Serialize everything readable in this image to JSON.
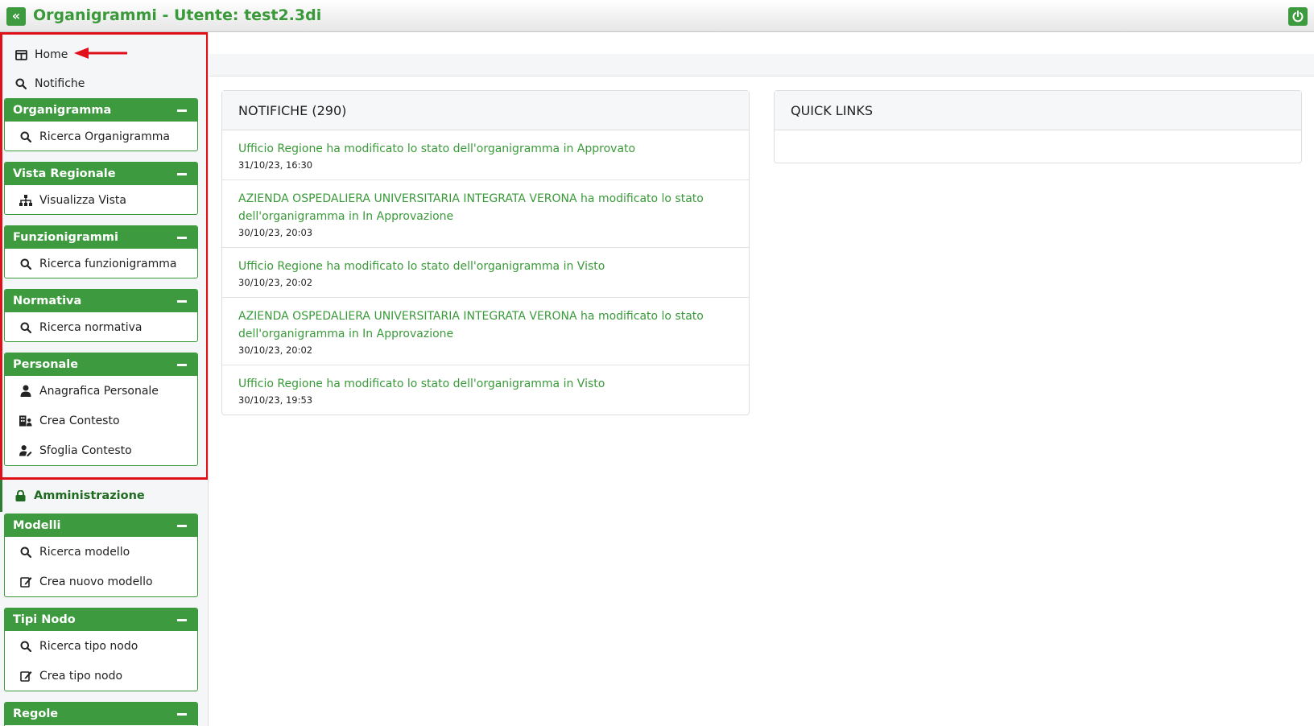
{
  "app": {
    "title": "Organigrammi - Utente: test2.3di",
    "collapse_glyph": "«"
  },
  "colors": {
    "brand_green": "#3e9a3e",
    "link_green": "#3a9a3a",
    "highlight_red": "#e0101a"
  },
  "sidebar": {
    "home": "Home",
    "notifiche": "Notifiche",
    "sections": [
      {
        "title": "Organigramma",
        "items": [
          {
            "label": "Ricerca Organigramma",
            "icon": "search-icon"
          }
        ]
      },
      {
        "title": "Vista Regionale",
        "items": [
          {
            "label": "Visualizza Vista",
            "icon": "sitemap-icon"
          }
        ]
      },
      {
        "title": "Funzionigrammi",
        "items": [
          {
            "label": "Ricerca funzionigramma",
            "icon": "search-icon"
          }
        ]
      },
      {
        "title": "Normativa",
        "items": [
          {
            "label": "Ricerca normativa",
            "icon": "search-icon"
          }
        ]
      },
      {
        "title": "Personale",
        "items": [
          {
            "label": "Anagrafica Personale",
            "icon": "user-icon"
          },
          {
            "label": "Crea Contesto",
            "icon": "building-user-icon"
          },
          {
            "label": "Sfoglia Contesto",
            "icon": "user-pen-icon"
          }
        ]
      }
    ],
    "admin_label": "Amministrazione",
    "admin_sections": [
      {
        "title": "Modelli",
        "items": [
          {
            "label": "Ricerca modello",
            "icon": "search-icon"
          },
          {
            "label": "Crea nuovo modello",
            "icon": "edit-icon"
          }
        ]
      },
      {
        "title": "Tipi Nodo",
        "items": [
          {
            "label": "Ricerca tipo nodo",
            "icon": "search-icon"
          },
          {
            "label": "Crea tipo nodo",
            "icon": "edit-icon"
          }
        ]
      },
      {
        "title": "Regole",
        "items": []
      }
    ]
  },
  "notifications": {
    "header": "NOTIFICHE (290)",
    "items": [
      {
        "message": "Ufficio Regione ha modificato lo stato dell'organigramma in Approvato",
        "time": "31/10/23, 16:30"
      },
      {
        "message": "AZIENDA OSPEDALIERA UNIVERSITARIA INTEGRATA VERONA ha modificato lo stato dell'organigramma in In Approvazione",
        "time": "30/10/23, 20:03"
      },
      {
        "message": "Ufficio Regione ha modificato lo stato dell'organigramma in Visto",
        "time": "30/10/23, 20:02"
      },
      {
        "message": "AZIENDA OSPEDALIERA UNIVERSITARIA INTEGRATA VERONA ha modificato lo stato dell'organigramma in In Approvazione",
        "time": "30/10/23, 20:02"
      },
      {
        "message": "Ufficio Regione ha modificato lo stato dell'organigramma in Visto",
        "time": "30/10/23, 19:53"
      }
    ]
  },
  "quick_links": {
    "header": "QUICK LINKS"
  }
}
